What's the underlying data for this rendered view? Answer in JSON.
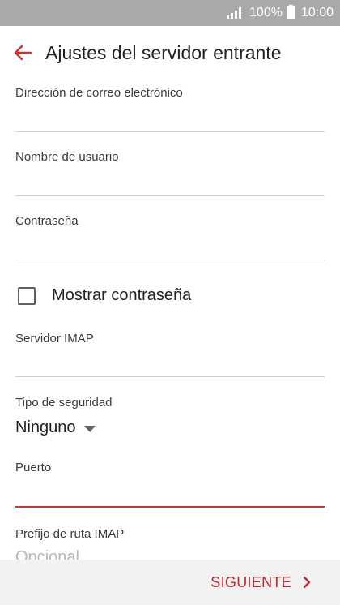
{
  "status_bar": {
    "battery": "100%",
    "time": "10:00",
    "signal_icon": "signal-bars-icon",
    "battery_icon": "battery-icon"
  },
  "app_bar": {
    "title": "Ajustes del servidor entrante",
    "back_icon": "back-arrow-icon",
    "accent_color": "#d0302f"
  },
  "form": {
    "email_label": "Dirección de correo electrónico",
    "username_label": "Nombre de usuario",
    "password_label": "Contraseña",
    "show_password_label": "Mostrar contraseña",
    "show_password_checked": false,
    "imap_server_label": "Servidor IMAP",
    "security_type_label": "Tipo de seguridad",
    "security_type_value": "Ninguno",
    "port_label": "Puerto",
    "imap_prefix_label": "Prefijo de ruta IMAP",
    "imap_prefix_placeholder": "Opcional"
  },
  "footer": {
    "next_label": "SIGUIENTE",
    "next_icon": "chevron-right-icon"
  }
}
